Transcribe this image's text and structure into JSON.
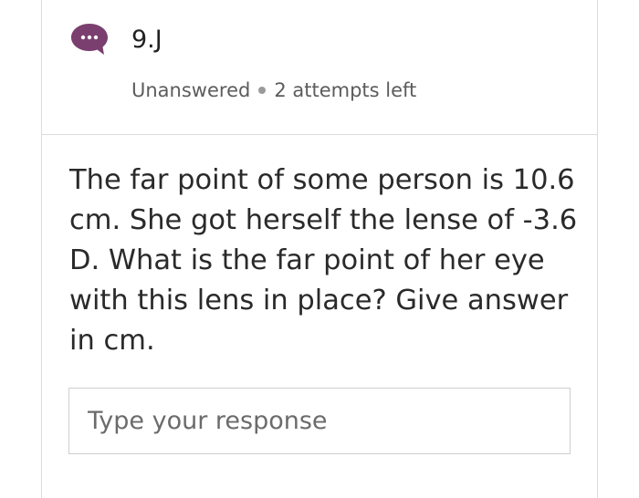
{
  "question": {
    "number": "9.J",
    "status": "Unanswered",
    "attempts": "2 attempts left",
    "text": "The far point of some person is 10.6 cm. She got herself the lense of -3.6 D. What is the far point of her eye with this lens in place? Give answer in cm."
  },
  "response": {
    "placeholder": "Type your response",
    "value": ""
  },
  "icons": {
    "chat": "chat-bubble-icon"
  },
  "colors": {
    "icon_bubble": "#7a3f6e",
    "border": "#dcdcdc",
    "text": "#2a2a2a",
    "muted_text": "#5c5c5c"
  }
}
